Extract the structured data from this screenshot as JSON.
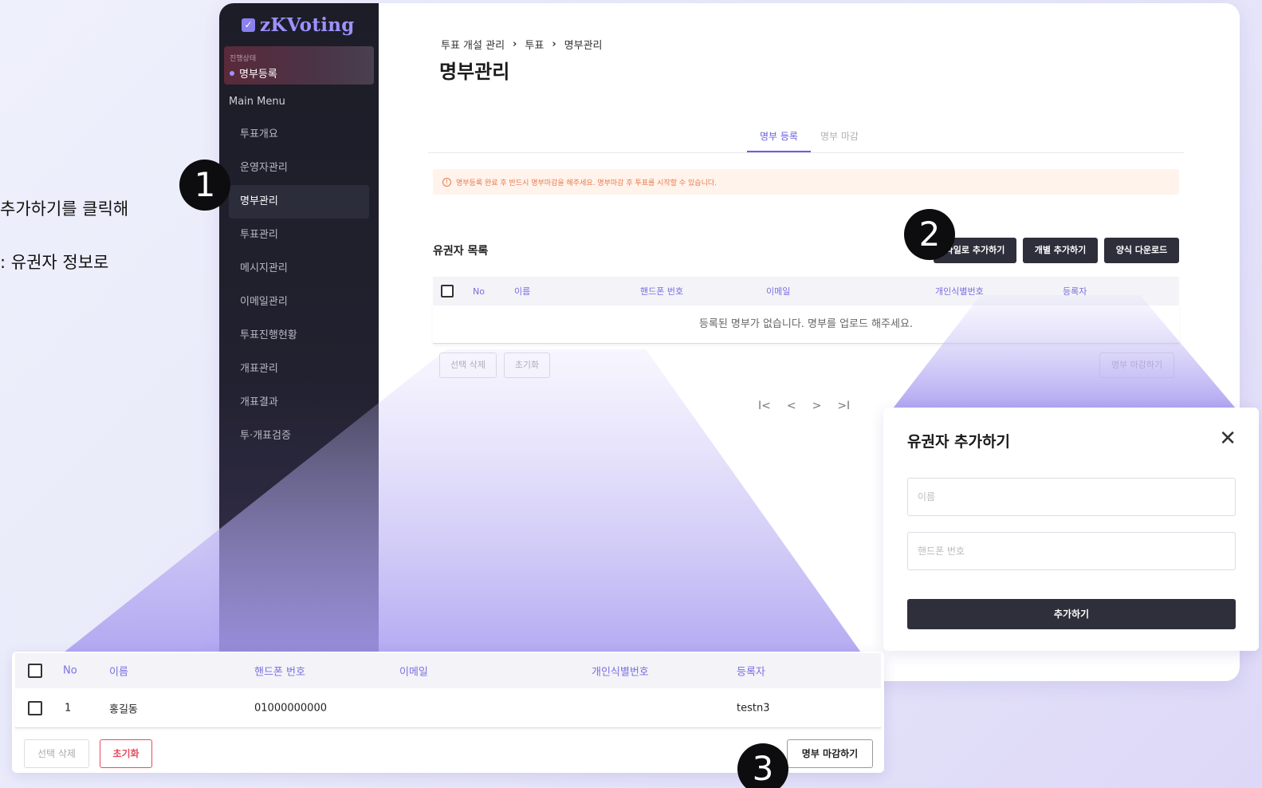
{
  "side_text": {
    "line1": "추가하기를 클릭해",
    "line2": ": 유권자 정보로"
  },
  "badges": {
    "b1": "1",
    "b2": "2",
    "b3": "3"
  },
  "sidebar": {
    "logo_mark": "✓",
    "logo": "zKVoting",
    "status_label": "진행상태",
    "status_value": "명부등록",
    "main_menu": "Main Menu",
    "items": [
      {
        "label": "투표개요"
      },
      {
        "label": "운영자관리"
      },
      {
        "label": "명부관리"
      },
      {
        "label": "투표관리"
      },
      {
        "label": "메시지관리"
      },
      {
        "label": "이메일관리"
      },
      {
        "label": "투표진행현황"
      },
      {
        "label": "개표관리"
      },
      {
        "label": "개표결과"
      },
      {
        "label": "투·개표검증"
      }
    ]
  },
  "breadcrumb": {
    "c1": "투표 개설 관리",
    "sep": "›",
    "c2": "투표",
    "c3": "명부관리"
  },
  "page_title": "명부관리",
  "tabs": {
    "register": "명부 등록",
    "close": "명부 마감"
  },
  "notice": "명부등록 완료 후 반드시 명부마감을 해주세요. 명부마감 후 투표를 시작할 수 있습니다.",
  "list": {
    "title": "유권자 목록",
    "btn_file": "파일로 추가하기",
    "btn_single": "개별 추가하기",
    "btn_template": "양식 다운로드",
    "headers": [
      "No",
      "이름",
      "핸드폰 번호",
      "이메일",
      "개인식별번호",
      "등록자"
    ],
    "empty": "등록된 명부가 없습니다. 명부를 업로드 해주세요.",
    "btn_delete": "선택 삭제",
    "btn_reset": "초기화",
    "btn_close_roster": "명부 마감하기",
    "pager": [
      "I<",
      "<",
      ">",
      ">I"
    ]
  },
  "modal": {
    "title": "유권자 추가하기",
    "close": "✕",
    "name_placeholder": "이름",
    "phone_placeholder": "핸드폰 번호",
    "submit": "추가하기"
  },
  "zoom": {
    "headers": [
      "No",
      "이름",
      "핸드폰 번호",
      "이메일",
      "개인식별번호",
      "등록자"
    ],
    "row": {
      "no": "1",
      "name": "홍길동",
      "phone": "01000000000",
      "email": "",
      "id": "",
      "registrant": "testn3"
    },
    "btn_delete": "선택 삭제",
    "btn_reset": "초기화",
    "btn_close_roster": "명부 마감하기"
  },
  "colors": {
    "accent": "#7b6fe0",
    "sidebar_bg": "#1c1d27",
    "dark_button": "#2e2f3b",
    "notice_text": "#e8794a",
    "reset_red": "#e84a5f"
  }
}
